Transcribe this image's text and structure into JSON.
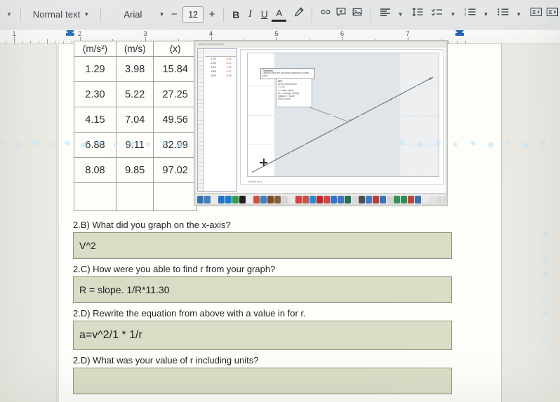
{
  "toolbar": {
    "style_label": "Normal text",
    "font_label": "Arial",
    "font_size": "12",
    "decrease_label": "−",
    "increase_label": "+",
    "bold_label": "B",
    "italic_label": "I",
    "underline_label": "U",
    "text_color_label": "A",
    "icons": [
      "style-dropdown-caret-icon",
      "font-dropdown-caret-icon",
      "text-color-icon",
      "highlight-pen-icon",
      "insert-link-icon",
      "add-comment-icon",
      "insert-image-icon",
      "align-icon",
      "line-spacing-icon",
      "checklist-icon",
      "numbered-list-icon",
      "bulleted-list-icon",
      "decrease-indent-icon",
      "increase-indent-icon"
    ]
  },
  "ruler": {
    "numbers": [
      "1",
      "2",
      "3",
      "4",
      "5",
      "6",
      "7"
    ],
    "left_indent_position": "1",
    "right_indent_position": "6.5"
  },
  "table": {
    "headers": [
      "(m/s²)",
      "(m/s)",
      "(x)"
    ],
    "rows": [
      [
        "1.29",
        "3.98",
        "15.84"
      ],
      [
        "2.30",
        "5.22",
        "27.25"
      ],
      [
        "4.15",
        "7.04",
        "49.56"
      ],
      [
        "6.88",
        "9.11",
        "82.99"
      ],
      [
        "8.08",
        "9.85",
        "97.02"
      ],
      [
        "",
        "",
        ""
      ]
    ]
  },
  "embedded_screenshot": {
    "window_title": "Untitled spreadsheet",
    "tooltip_title": "Trendline",
    "tooltip_body": "Linear fit best line\nUse these equations to label point",
    "legend_title": "KEY",
    "legend_items": [
      "Linear (best fit) line",
      "v = vel",
      "x = Mass matrix",
      "a/r = average velocity",
      "Variance = slope",
      "RMS curved"
    ],
    "x_axis_label": "a (m/s²) vs v²",
    "dock_label": "macOS dock"
  },
  "questions": [
    {
      "id": "2.B",
      "prompt": "2.B) What did you graph on the x-axis?",
      "answer": "V^2"
    },
    {
      "id": "2.C",
      "prompt": "2.C) How were you able to find r from your graph?",
      "answer": "R = slope. 1/R*11.30"
    },
    {
      "id": "2.D",
      "prompt": "2.D) Rewrite the equation from above with a value in for r.",
      "answer": "a=v^2/1 * 1/r"
    },
    {
      "id": "2.D2",
      "prompt": "2.D) What was your value of r including units?",
      "answer": ""
    }
  ],
  "colors": {
    "answer_box_fill": "#d7ddc2",
    "answer_box_border": "#8e947c",
    "toolbar_bg": "#e8ebed",
    "page_bg": "#fdfdfa",
    "indent_marker": "#1565c0"
  }
}
